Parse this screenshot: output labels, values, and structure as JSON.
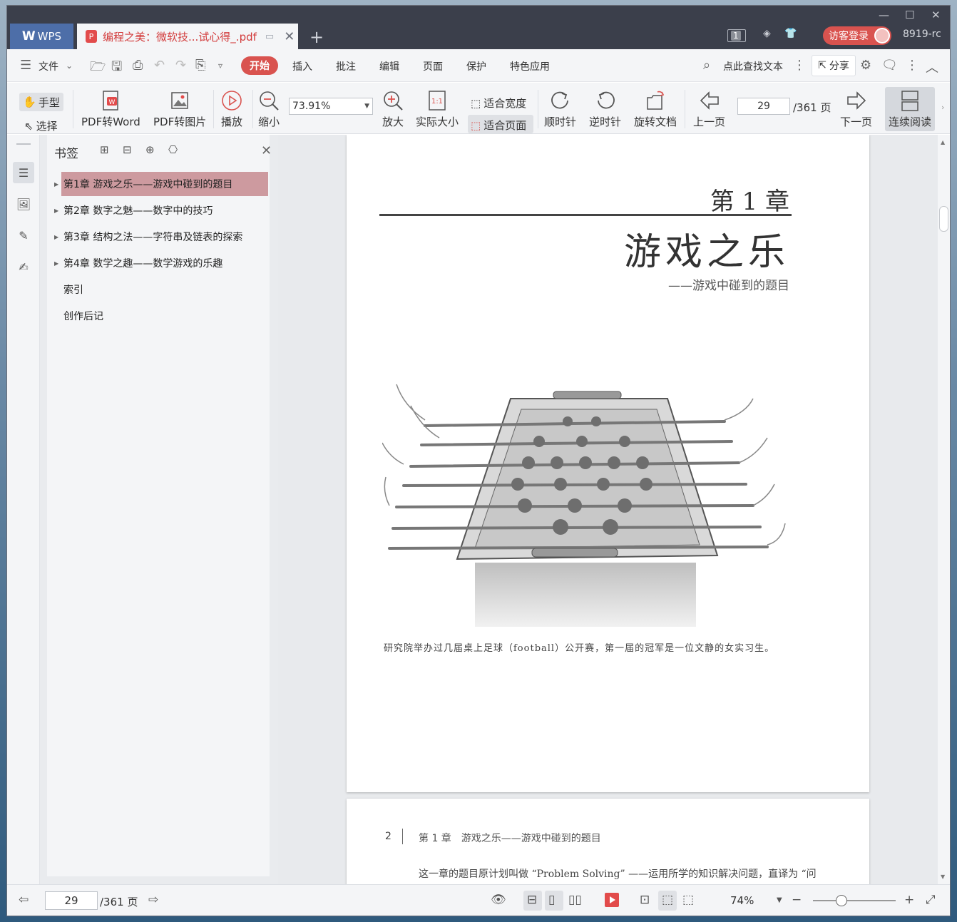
{
  "titlebar": {
    "app_tab": "WPS",
    "app_logo": "W",
    "doc_tab": "编程之美：微软技...试心得_.pdf",
    "badge_count": "1",
    "login_label": "访客登录",
    "user_id": "8919-rc"
  },
  "menubar": {
    "file": "文件",
    "start": "开始",
    "insert": "插入",
    "annotate": "批注",
    "edit": "编辑",
    "page": "页面",
    "protect": "保护",
    "special": "特色应用",
    "search": "点此查找文本",
    "share": "分享"
  },
  "toolbar": {
    "hand": "手型",
    "select": "选择",
    "pdf_to_word": "PDF转Word",
    "pdf_to_image": "PDF转图片",
    "play": "播放",
    "zoom_out": "缩小",
    "zoom_value": "73.91%",
    "zoom_in": "放大",
    "actual_size": "实际大小",
    "fit_width": "适合宽度",
    "fit_page": "适合页面",
    "clockwise": "顺时针",
    "counterclockwise": "逆时针",
    "rotate_doc": "旋转文档",
    "prev_page": "上一页",
    "page_value": "29",
    "page_total": "/361 页",
    "next_page": "下一页",
    "continuous": "连续阅读"
  },
  "bookmarks": {
    "header": "书签",
    "items": [
      {
        "label": "第1章 游戏之乐——游戏中碰到的题目",
        "expandable": true,
        "selected": true
      },
      {
        "label": "第2章 数字之魅——数字中的技巧",
        "expandable": true,
        "selected": false
      },
      {
        "label": "第3章 结构之法——字符串及链表的探索",
        "expandable": true,
        "selected": false
      },
      {
        "label": "第4章 数学之趣——数学游戏的乐趣",
        "expandable": true,
        "selected": false
      },
      {
        "label": "索引",
        "expandable": false,
        "selected": false
      },
      {
        "label": "创作后记",
        "expandable": false,
        "selected": false
      }
    ]
  },
  "document": {
    "page1": {
      "chapter_number": "第 1 章",
      "chapter_title": "游戏之乐",
      "chapter_subtitle": "——游戏中碰到的题目",
      "caption": "研究院举办过几届桌上足球（football）公开赛，第一届的冠军是一位文静的女实习生。"
    },
    "page2": {
      "page_number": "2",
      "running_head": "第 1 章　游戏之乐——游戏中碰到的题目",
      "body_first_line": "这一章的题目原计划叫做 “Problem Solving” ——运用所学的知识解决问题，直译为 “问"
    }
  },
  "statusbar": {
    "page_value": "29",
    "page_total": "/361 页",
    "zoom": "74%"
  },
  "colors": {
    "accent_red": "#d9534f",
    "selected_bookmark": "#cd9a9f",
    "titlebar": "#3b3f4b",
    "wps_tab": "#4d6ea8"
  }
}
